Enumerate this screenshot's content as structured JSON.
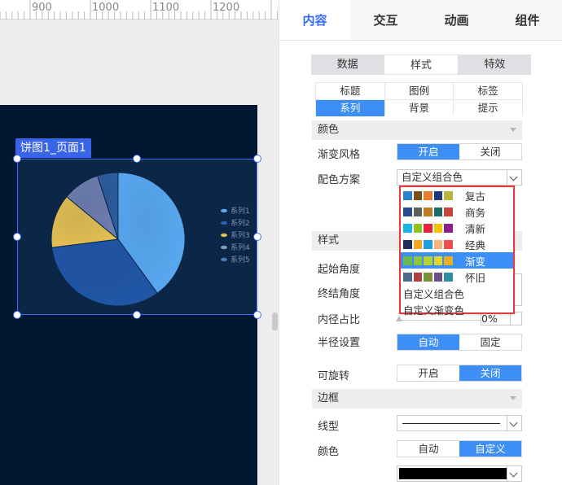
{
  "ruler": {
    "labels": [
      "900",
      "1000",
      "1100",
      "1200"
    ]
  },
  "chart": {
    "title": "饼图1_页面1",
    "legend": [
      "系列1",
      "系列2",
      "系列3",
      "系列4",
      "系列5"
    ],
    "colors": [
      "#5aa9f2",
      "#2157a8",
      "#e4c052",
      "#6f7eb0",
      "#2d5d9e"
    ],
    "legend_dot_colors": [
      "#5aa9f2",
      "#2a63b5",
      "#e4c052",
      "#8a97c5",
      "#4b7ac1"
    ]
  },
  "chart_data": {
    "type": "pie",
    "categories": [
      "系列1",
      "系列2",
      "系列3",
      "系列4",
      "系列5"
    ],
    "values": [
      40,
      33,
      13,
      9,
      5
    ],
    "title": ""
  },
  "panel": {
    "main_tabs": [
      "内容",
      "交互",
      "动画",
      "组件"
    ],
    "sub_tabs": [
      "数据",
      "样式",
      "特效"
    ],
    "third_tabs": [
      "标题",
      "图例",
      "标签",
      "系列",
      "背景",
      "提示"
    ],
    "sections": {
      "color": "颜色",
      "style": "样式",
      "border": "边框"
    },
    "labels": {
      "gradient_style": "渐变风格",
      "color_scheme": "配色方案",
      "start_angle": "起始角度",
      "end_angle": "终结角度",
      "inner_ratio": "内径占比",
      "radius": "半径设置",
      "rotatable": "可旋转",
      "line_type": "线型",
      "border_color": "颜色"
    },
    "toggles": {
      "gradient": [
        "开启",
        "关闭"
      ],
      "radius": [
        "自动",
        "固定"
      ],
      "rotatable": [
        "开启",
        "关闭"
      ],
      "border_color": [
        "自动",
        "自定义"
      ]
    },
    "color_scheme_value": "自定义组合色",
    "inner_ratio_value": "0%",
    "dropdown": {
      "items": [
        {
          "name": "复古",
          "colors": [
            "#2a82c8",
            "#7a4f1e",
            "#e87d2f",
            "#1e3a7a",
            "#b9b63a"
          ]
        },
        {
          "name": "商务",
          "colors": [
            "#2b4d8f",
            "#5e5e5e",
            "#c07b22",
            "#1b6b6b",
            "#c4463a"
          ]
        },
        {
          "name": "清新",
          "colors": [
            "#1ab4e0",
            "#8fc31f",
            "#e8213d",
            "#f4c200",
            "#8b1f8b"
          ]
        },
        {
          "name": "经典",
          "colors": [
            "#1f2f5a",
            "#f5a623",
            "#1e9de0",
            "#f7b37a",
            "#f04e4e"
          ]
        },
        {
          "name": "渐变",
          "colors": [
            "#6cb84b",
            "#8fc43e",
            "#b9d232",
            "#e0d828",
            "#e8b020"
          ]
        },
        {
          "name": "怀旧",
          "colors": [
            "#4a6b8a",
            "#b04040",
            "#7a8f3a",
            "#6a4f8a",
            "#2f8fa0"
          ]
        }
      ],
      "text_items": [
        "自定义组合色",
        "自定义渐变色"
      ]
    }
  }
}
